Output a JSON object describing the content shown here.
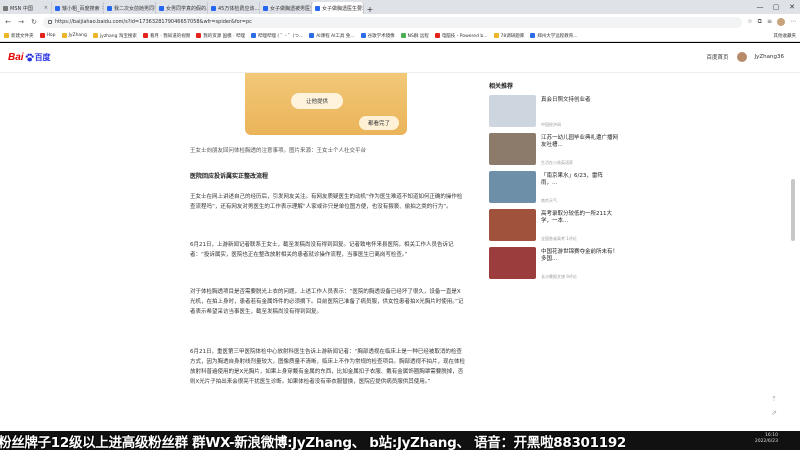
{
  "browser": {
    "tabs": [
      {
        "title": "MSN 中国",
        "fav": "gray",
        "active": false
      },
      {
        "title": "矮小粗_百度搜索",
        "fav": "blue",
        "active": false
      },
      {
        "title": "我二次女前她男同学都说...",
        "fav": "blue",
        "active": false
      },
      {
        "title": "女男同学真的假的...",
        "fav": "blue",
        "active": false
      },
      {
        "title": "45万体检费应该...",
        "fav": "blue",
        "active": false
      },
      {
        "title": "女子做胸透被男医生...",
        "fav": "blue",
        "active": false
      },
      {
        "title": "女子做胸透医生要求脱衣...",
        "fav": "blue",
        "active": true
      }
    ],
    "new_tab": "+",
    "window_controls": [
      "—",
      "▢",
      "✕"
    ],
    "url": "https://baijiahao.baidu.com/s?id=1736328179046657058&wfr=spider&for=pc",
    "bookmarks": [
      {
        "label": "新建文件夹",
        "icon": "y"
      },
      {
        "label": "Hop",
        "icon": "r"
      },
      {
        "label": "JyZhang",
        "icon": "y"
      },
      {
        "label": "jyzhang 淘宝搜索",
        "icon": "y"
      },
      {
        "label": "看月 · 我知道的视频",
        "icon": "r"
      },
      {
        "label": "我的资源 国模 · 哔哩",
        "icon": "r"
      },
      {
        "label": "哔哩哔哩 ( ゜- ゜)つ...",
        "icon": "b"
      },
      {
        "label": "AI课程 AI工具 免...",
        "icon": "b"
      },
      {
        "label": "谷歌学术镜像",
        "icon": "b"
      },
      {
        "label": "NS群 远程",
        "icon": "g"
      },
      {
        "label": "电脑技 - Powered b...",
        "icon": "r"
      },
      {
        "label": "78调研题库",
        "icon": "y"
      },
      {
        "label": "郑州大学远程教育...",
        "icon": "b"
      }
    ],
    "bookmarks_right": "其他收藏夹"
  },
  "header": {
    "logo_bai": "Bai",
    "logo_du": "百度",
    "home_link": "百度首页",
    "username": "JyZhang36"
  },
  "article": {
    "img_button": "让他提供",
    "img_button2": "都看完了",
    "caption": "王女士向朋友回问体检胸透的注意事项。图片来源：王女士个人社交平台",
    "subhead": "医院回应投诉属实正整改流程",
    "paragraphs": [
      "王女士在网上讲述自己的经历后，引发网友关注。有网友质疑医生的动机“作为医生难道不知道如何正确的操作检查流程吗”，还有网友对男医生的工作表示理解“人家或许只是单位图方便，也没有猥亵、偷拍之类的行为”。",
      "6月21日，上游新闻记者联系王女士，截至发稿尚没有得到回复。记者致电怀来县医院，相关工作人员告诉记者：“投诉属实，医院也正在整改放射相关的患者就诊操作流程，当事医生已离岗写检查。”",
      "对于体检胸透项目是否需要脱光上衣的问题，上述工作人员表示：“医院的胸透设备已经坏了很久，设备一直是X光机，在拍上身时，患者若有金属饰件的必须摘下。目前医院已准备了病员服，供女性患者拍X光胸片时使用。”记者表示希望采访当事医生，截至发稿尚没有得到回复。",
      "6月21日，重医第三甲医院体检中心放射科医生告诉上游新闻记者：“胸部透视在临床上是一种已经被取消的检查方式，因为胸透自身射线剂量较大，图像质量不清晰，临床上不作为常规的检查项目。胸部透视不拍片，现在体检放射科普遍使用的是X光胸片，如果上身穿戴有金属的东西，比如金属扣子衣服、戴有金属饰圈胸罩需要脱掉，否则X光片子拍出来会很亮干扰医生诊断。如果体检者没有带衣服替换，医院应提供病员服供其使用。”"
    ]
  },
  "sidebar": {
    "title": "相关推荐",
    "items": [
      {
        "title": "真会日照文持创业者",
        "meta": "中国经济网",
        "thumb": "#cdd6de"
      },
      {
        "title": "江苏一幼儿园毕业典礼遭广播网友吐槽...",
        "meta": "生活在小孩英语家",
        "thumb": "#8c7b6a"
      },
      {
        "title": "「南京果水」6/23，雷阵雨，...",
        "meta": "南京天气",
        "thumb": "#6e8fa8"
      },
      {
        "title": "高考录取分较低的一所211大学，一本...",
        "meta": "全国各省高考 1评论",
        "thumb": "#a0523d"
      },
      {
        "title": "中国花游世锦赛夺金前所未有！多国...",
        "meta": "长沙晚报文旅 9评论",
        "thumb": "#9b3d3d"
      }
    ]
  },
  "banner": {
    "text": "粉丝牌子12级以上进高级粉丝群  群WX-新浪微博:JyZhang、 b站:JyZhang、 语音：开黑啦88301192"
  },
  "taskbar": {
    "time": "16:10",
    "date": "2022/6/23"
  }
}
